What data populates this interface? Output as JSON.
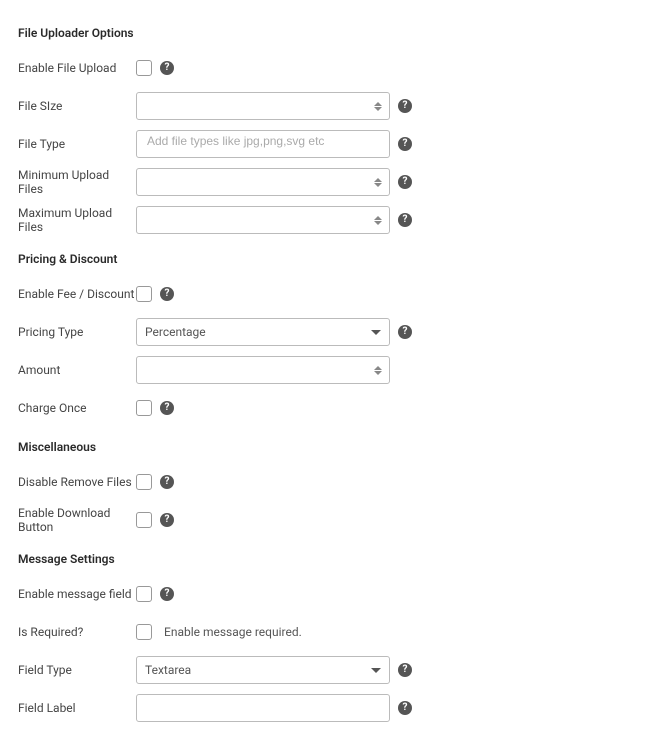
{
  "sections": {
    "file_uploader": {
      "title": "File Uploader Options",
      "enable_file_upload": {
        "label": "Enable File Upload"
      },
      "file_size": {
        "label": "File SIze"
      },
      "file_type": {
        "label": "File Type",
        "placeholder": "Add file types like jpg,png,svg etc"
      },
      "min_upload": {
        "label": "Minimum Upload Files"
      },
      "max_upload": {
        "label": "Maximum Upload Files"
      }
    },
    "pricing": {
      "title": "Pricing & Discount",
      "enable_fee": {
        "label": "Enable Fee / Discount"
      },
      "pricing_type": {
        "label": "Pricing Type",
        "value": "Percentage"
      },
      "amount": {
        "label": "Amount"
      },
      "charge_once": {
        "label": "Charge Once"
      }
    },
    "misc": {
      "title": "Miscellaneous",
      "disable_remove": {
        "label": "Disable Remove Files"
      },
      "enable_download": {
        "label": "Enable Download Button"
      }
    },
    "message": {
      "title": "Message Settings",
      "enable_message_field": {
        "label": "Enable message field"
      },
      "is_required": {
        "label": "Is Required?",
        "inline": "Enable message required."
      },
      "field_type": {
        "label": "Field Type",
        "value": "Textarea"
      },
      "field_label": {
        "label": "Field Label"
      }
    }
  }
}
